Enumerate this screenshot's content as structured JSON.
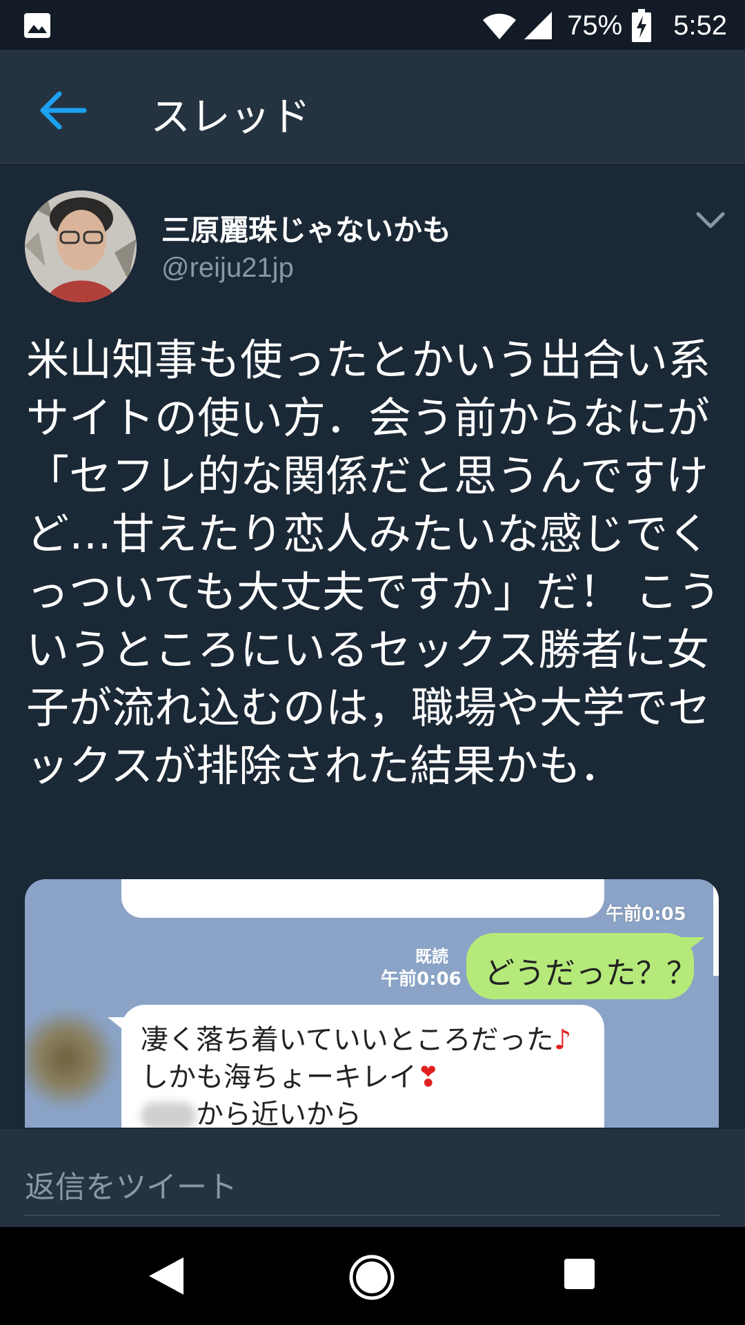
{
  "status_bar": {
    "battery": "75%",
    "time": "5:52",
    "icons": [
      "image-icon",
      "wifi-icon",
      "signal-icon",
      "battery-charging-icon"
    ]
  },
  "header": {
    "title": "スレッド",
    "back_icon": "arrow-left-icon",
    "accent_color": "#1da1f2"
  },
  "tweet": {
    "display_name": "三原麗珠じゃないかも",
    "handle": "@reiju21jp",
    "text": "米山知事も使ったとかいう出合い系サイトの使い方．会う前からなにが「セフレ的な関係だと思うんですけど…甘えたり恋人みたいな感じでくっついても大丈夫ですか」だ！ こういうところにいるセックス勝者に女子が流れ込むのは，職場や大学でセックスが排除された結果かも．",
    "media": {
      "time_top": "午前0:05",
      "read_label": "既読",
      "time_mid": "午前0:06",
      "sent_message": "どうだった？？",
      "received_line_1": "凄く落ち着いていいところだった",
      "received_line_1_emoji": "♪",
      "received_line_2": "しかも海ちょーキレイ",
      "received_line_2_emoji": "❣",
      "received_line_3": "から近いから"
    }
  },
  "reply": {
    "placeholder": "返信をツイート"
  },
  "nav": {
    "icons": [
      "nav-back-icon",
      "nav-home-icon",
      "nav-recents-icon"
    ]
  }
}
